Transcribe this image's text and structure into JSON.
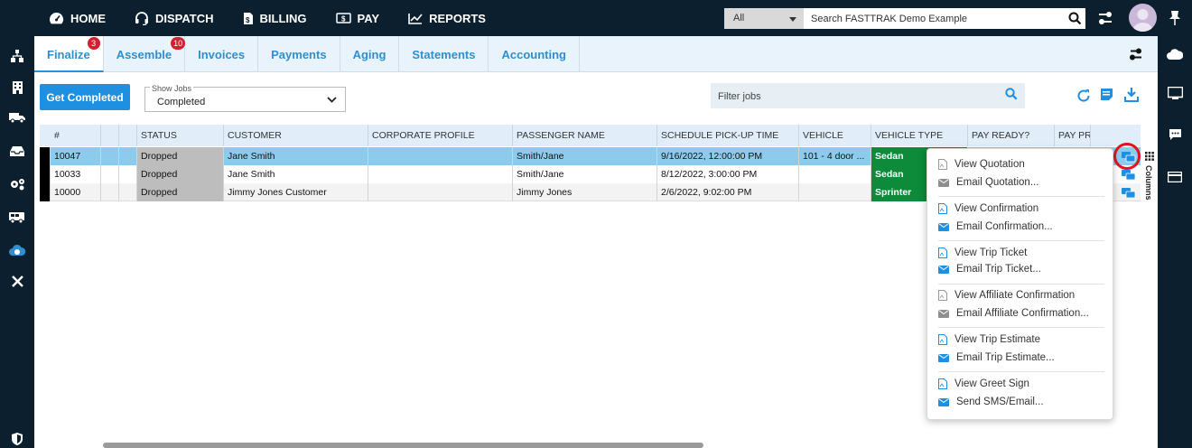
{
  "topnav": {
    "items": [
      {
        "label": "HOME",
        "icon": "dashboard-icon"
      },
      {
        "label": "DISPATCH",
        "icon": "headset-icon"
      },
      {
        "label": "BILLING",
        "icon": "invoice-icon"
      },
      {
        "label": "PAY",
        "icon": "money-icon"
      },
      {
        "label": "REPORTS",
        "icon": "chart-icon"
      }
    ],
    "search_scope": "All",
    "search_placeholder": "Search FASTTRAK Demo Example"
  },
  "tabs": [
    {
      "label": "Finalize",
      "badge": "3",
      "active": true
    },
    {
      "label": "Assemble",
      "badge": "10"
    },
    {
      "label": "Invoices"
    },
    {
      "label": "Payments"
    },
    {
      "label": "Aging"
    },
    {
      "label": "Statements"
    },
    {
      "label": "Accounting"
    }
  ],
  "toolbar": {
    "get_completed_label": "Get Completed",
    "show_jobs_label": "Show Jobs",
    "show_jobs_value": "Completed",
    "filter_placeholder": "Filter jobs"
  },
  "grid": {
    "columns": [
      "#",
      "STATUS",
      "CUSTOMER",
      "CORPORATE PROFILE",
      "PASSENGER NAME",
      "SCHEDULE PICK-UP TIME",
      "VEHICLE",
      "VEHICLE TYPE",
      "PAY READY?",
      "PAY PR"
    ],
    "rows": [
      {
        "id": "10047",
        "status": "Dropped",
        "customer": "Jane Smith",
        "corporate": "",
        "passenger": "Smith/Jane",
        "pickup": "9/16/2022, 12:00:00 PM",
        "vehicle": "101 - 4 door ...",
        "vehicle_type": "Sedan",
        "selected": true
      },
      {
        "id": "10033",
        "status": "Dropped",
        "customer": "Jane Smith",
        "corporate": "",
        "passenger": "Smith/Jane",
        "pickup": "8/12/2022, 3:00:00 PM",
        "vehicle": "",
        "vehicle_type": "Sedan"
      },
      {
        "id": "10000",
        "status": "Dropped",
        "customer": "Jimmy Jones Customer",
        "corporate": "",
        "passenger": "Jimmy Jones",
        "pickup": "2/6/2022, 9:02:00 PM",
        "vehicle": "",
        "vehicle_type": "Sprinter"
      }
    ],
    "columns_panel_label": "Columns"
  },
  "context_menu": {
    "items": [
      {
        "label": "View Quotation",
        "icon": "pdf-icon-grey"
      },
      {
        "label": "Email Quotation...",
        "icon": "envelope-icon-grey"
      },
      {
        "label": "View Confirmation",
        "icon": "pdf-icon"
      },
      {
        "label": "Email Confirmation...",
        "icon": "envelope-icon"
      },
      {
        "label": "View Trip Ticket",
        "icon": "pdf-icon"
      },
      {
        "label": "Email Trip Ticket...",
        "icon": "envelope-icon"
      },
      {
        "label": "View Affiliate Confirmation",
        "icon": "pdf-icon-grey"
      },
      {
        "label": "Email Affiliate Confirmation...",
        "icon": "envelope-icon-grey"
      },
      {
        "label": "View Trip Estimate",
        "icon": "pdf-icon"
      },
      {
        "label": "Email Trip Estimate...",
        "icon": "envelope-icon"
      },
      {
        "label": "View Greet Sign",
        "icon": "pdf-icon"
      },
      {
        "label": "Send SMS/Email...",
        "icon": "envelope-icon"
      }
    ]
  },
  "colors": {
    "nav_bg": "#0b1f2e",
    "accent": "#2f8fce",
    "primary_button": "#1e8fe1",
    "vehicle_type_bg": "#0d8a3a",
    "selected_row": "#8ccbed",
    "status_bg": "#bdbdbd",
    "badge": "#d3202f",
    "highlight_ring": "#e3131f"
  }
}
